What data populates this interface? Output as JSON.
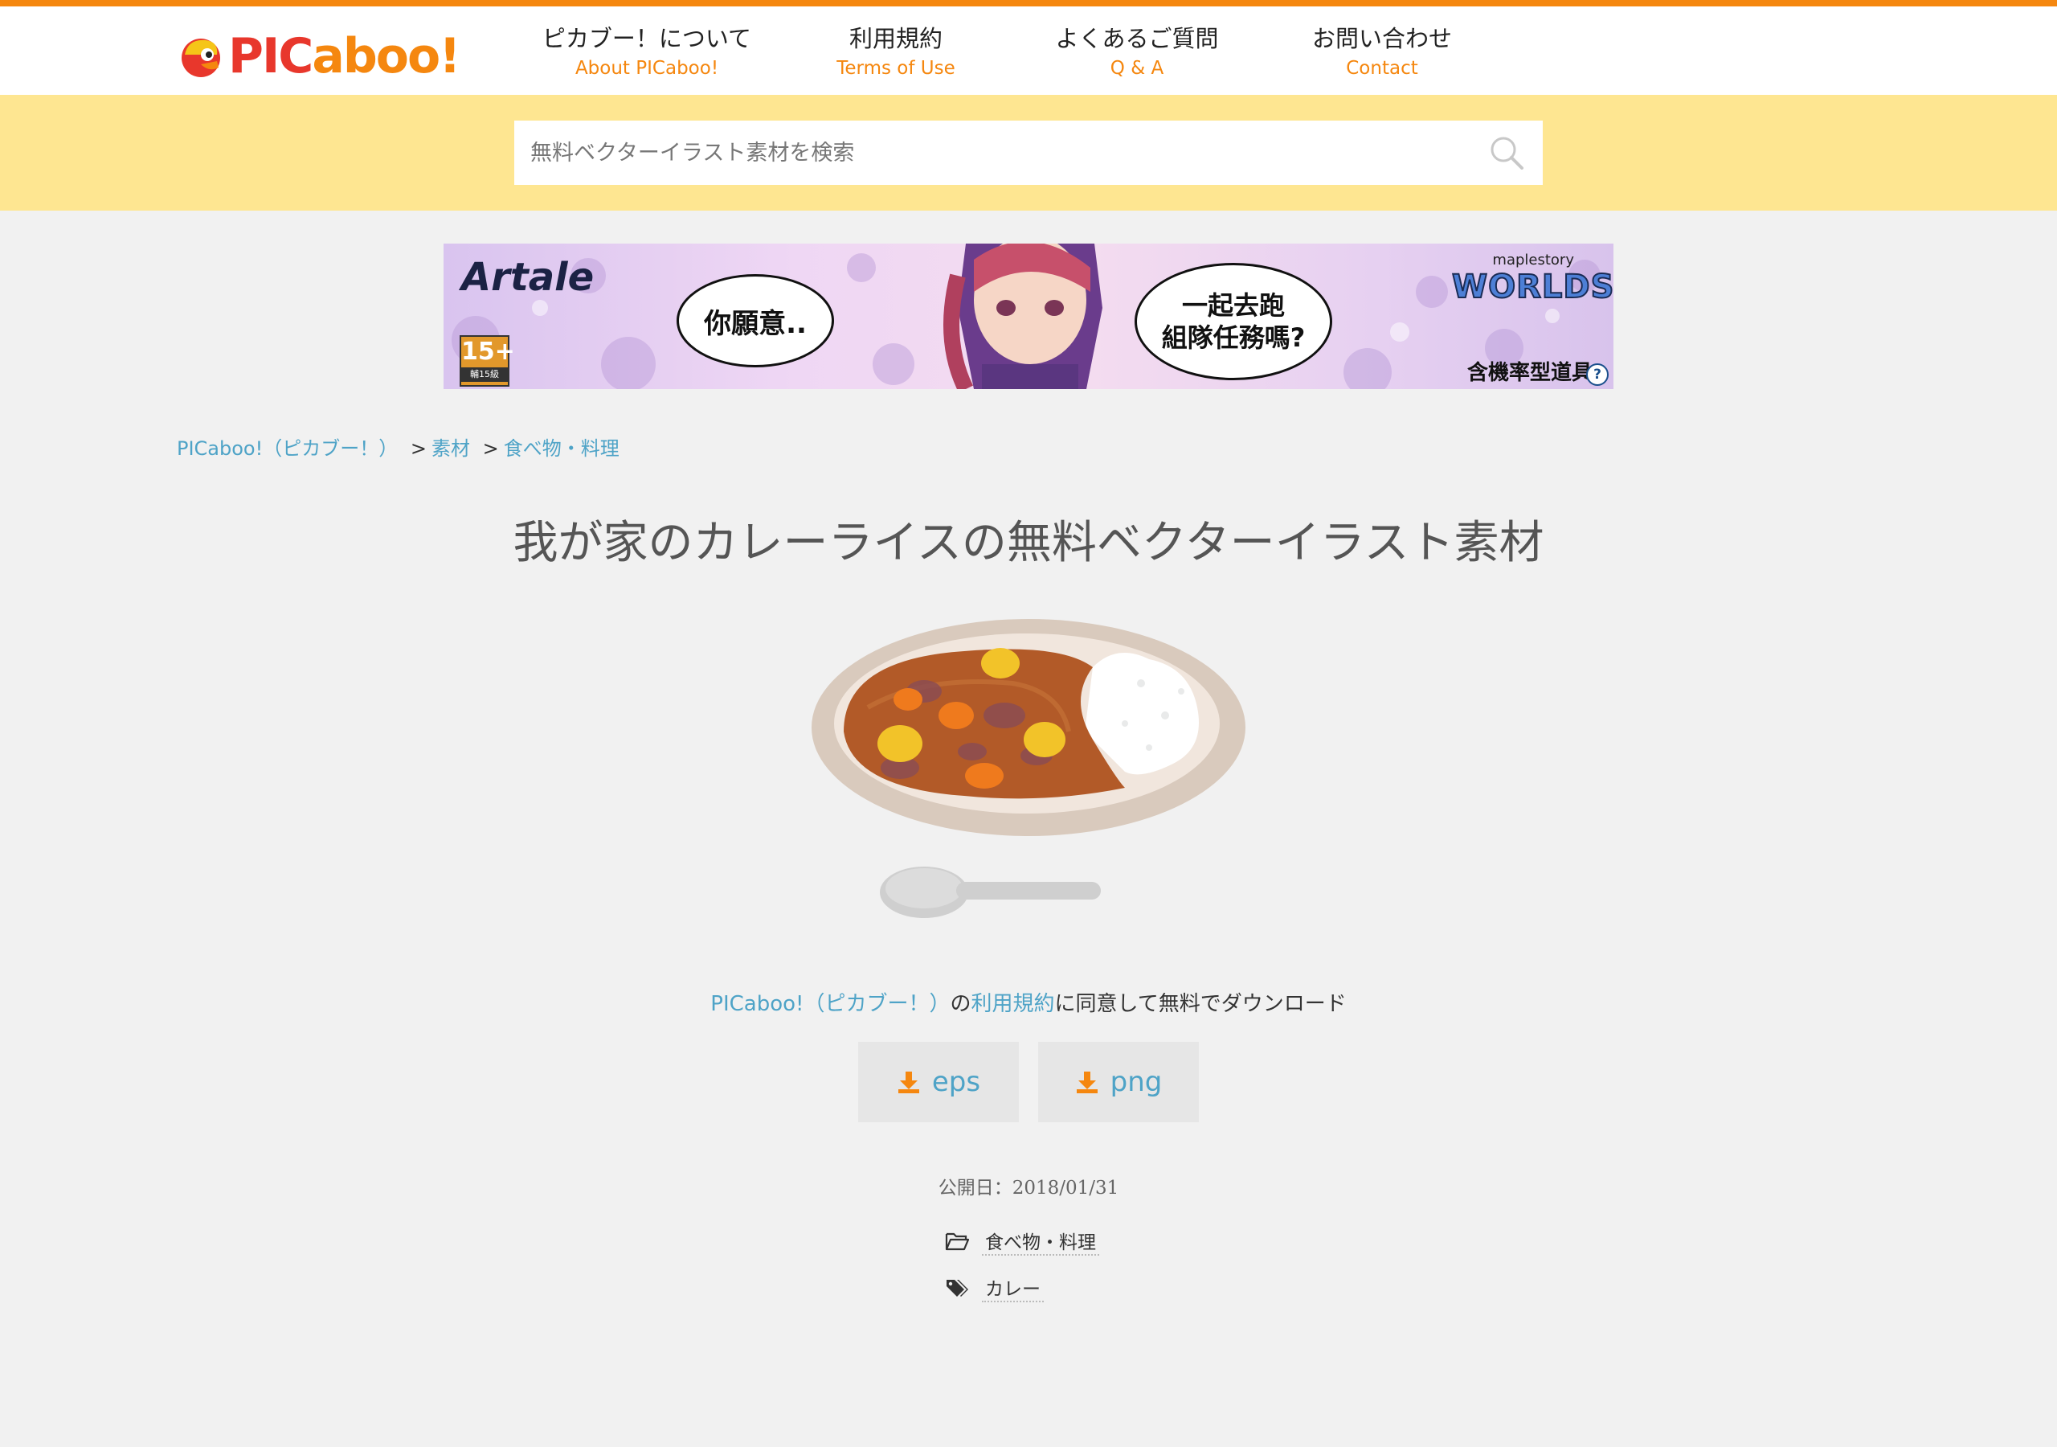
{
  "header": {
    "logo": "PICaboo!",
    "logo_parts": {
      "pic": "PIC",
      "aboo": "aboo!"
    },
    "nav": [
      {
        "jp": "ピカブー！について",
        "en": "About PICaboo!"
      },
      {
        "jp": "利用規約",
        "en": "Terms of Use"
      },
      {
        "jp": "よくあるご質問",
        "en": "Q & A"
      },
      {
        "jp": "お問い合わせ",
        "en": "Contact"
      }
    ]
  },
  "search": {
    "placeholder": "無料ベクターイラスト素材を検索"
  },
  "ad": {
    "brand": "Artale",
    "rating": "15+",
    "rating_sub": "輔15級",
    "bubble1": "你願意..",
    "bubble2_line1": "一起去跑",
    "bubble2_line2": "組隊任務嗎?",
    "logo_top": "maplestory",
    "logo_main": "WORLDS",
    "disclaimer": "含機率型道具",
    "info": "?"
  },
  "breadcrumb": {
    "home": "PICaboo!（ピカブー！）",
    "sep": ">",
    "level1": "素材",
    "level2": "食べ物・料理"
  },
  "title": "我が家のカレーライスの無料ベクターイラスト素材",
  "agreement": {
    "site": "PICaboo!（ピカブー！）",
    "no": "の",
    "terms": "利用規約",
    "rest": "に同意して無料でダウンロード"
  },
  "downloads": [
    {
      "label": "eps"
    },
    {
      "label": "png"
    }
  ],
  "published": "公開日：2018/01/31",
  "category": "食べ物・料理",
  "tag": "カレー",
  "colors": {
    "accent": "#f5870f",
    "link": "#4ea3c7",
    "search_band": "#fee691",
    "background": "#f1f1f1"
  }
}
